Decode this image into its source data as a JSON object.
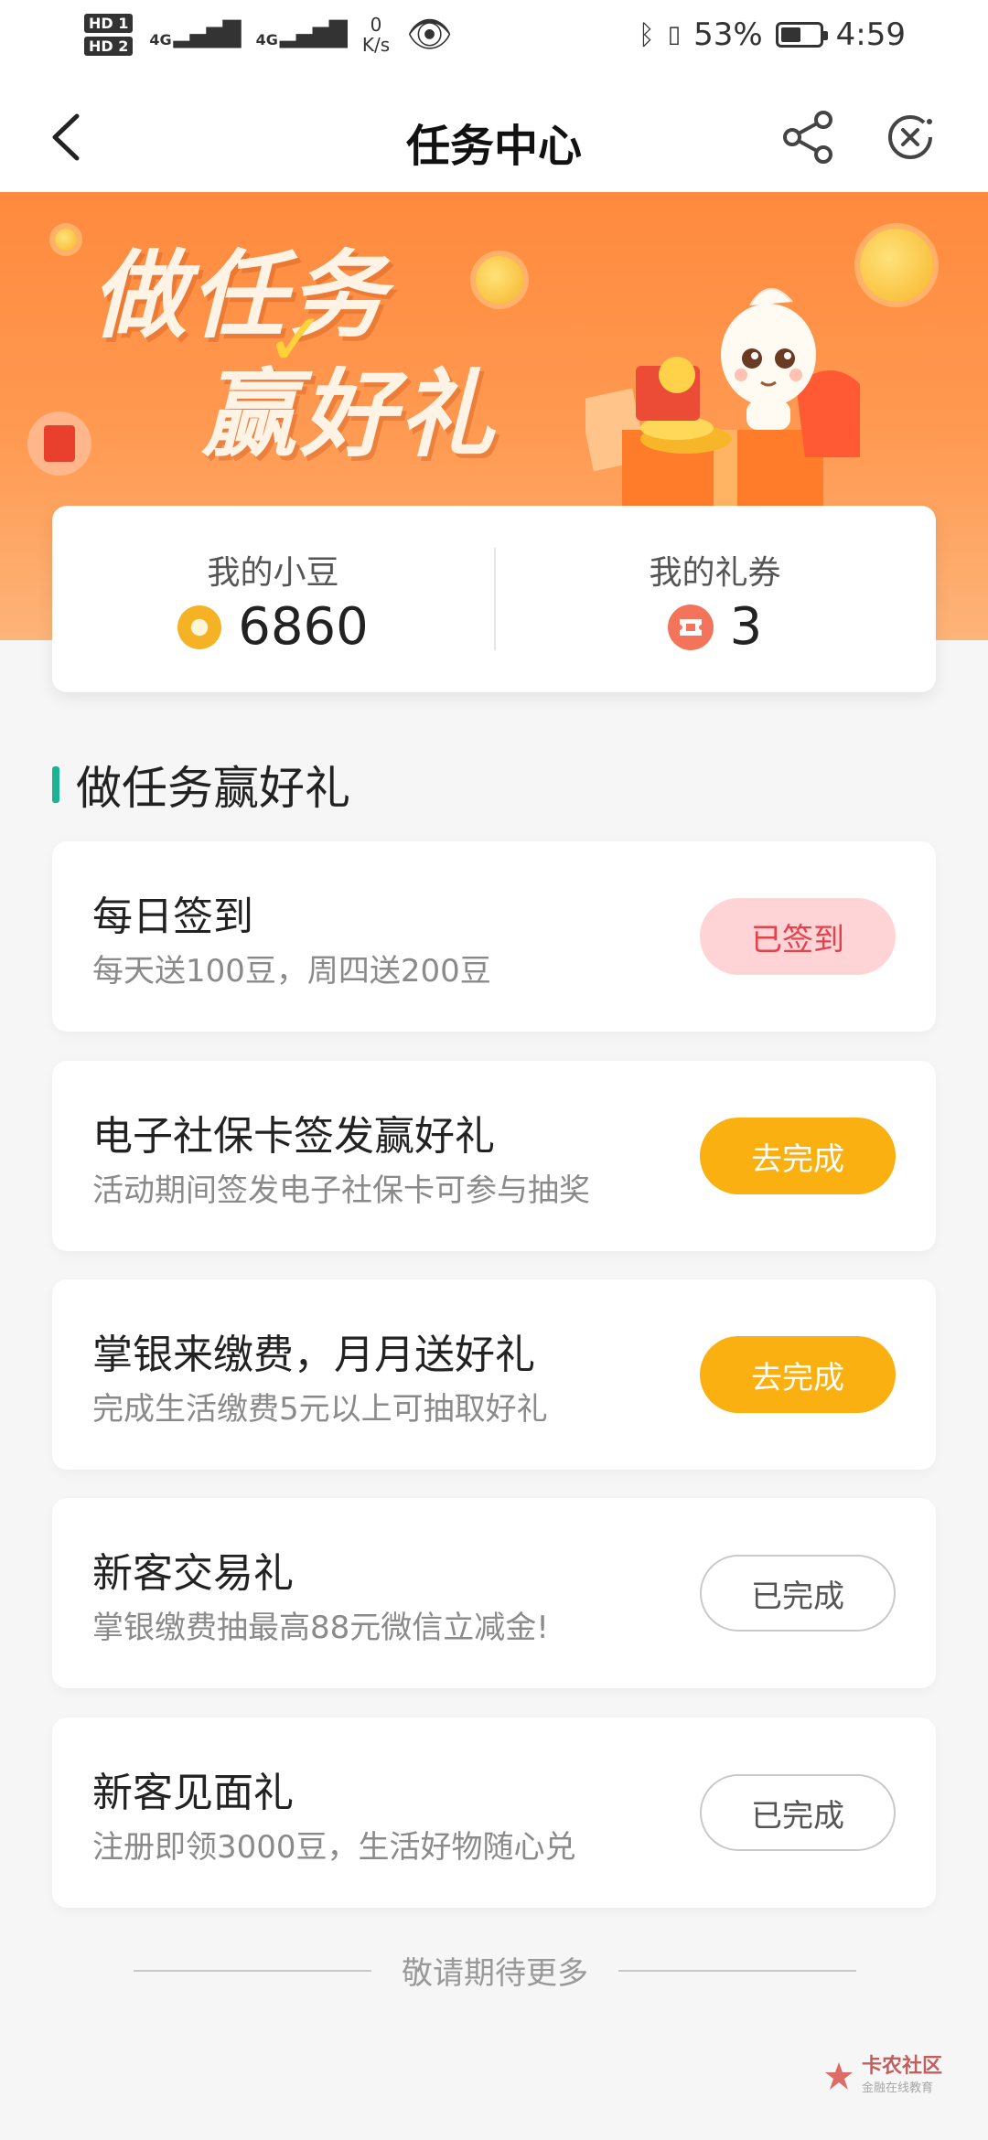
{
  "status_bar": {
    "hd1": "HD 1",
    "hd2": "HD 2",
    "sig1": "4G",
    "sig2": "4G",
    "net_speed": "0",
    "net_unit": "K/s",
    "battery_percent": "53%",
    "battery_level": 0.53,
    "time": "4:59"
  },
  "nav": {
    "title": "任务中心"
  },
  "banner": {
    "line1": "做任务",
    "line2": "赢好礼"
  },
  "balance": {
    "beans_label": "我的小豆",
    "beans_value": "6860",
    "coupons_label": "我的礼券",
    "coupons_value": "3"
  },
  "section": {
    "title": "做任务赢好礼"
  },
  "tasks": [
    {
      "title": "每日签到",
      "desc": "每天送100豆，周四送200豆",
      "button": "已签到",
      "state": "signed"
    },
    {
      "title": "电子社保卡签发赢好礼",
      "desc": "活动期间签发电子社保卡可参与抽奖",
      "button": "去完成",
      "state": "go"
    },
    {
      "title": "掌银来缴费，月月送好礼",
      "desc": "完成生活缴费5元以上可抽取好礼",
      "button": "去完成",
      "state": "go"
    },
    {
      "title": "新客交易礼",
      "desc": "掌银缴费抽最高88元微信立减金!",
      "button": "已完成",
      "state": "done"
    },
    {
      "title": "新客见面礼",
      "desc": "注册即领3000豆，生活好物随心兑",
      "button": "已完成",
      "state": "done"
    }
  ],
  "footer": {
    "text": "敬请期待更多"
  },
  "watermark": {
    "name": "卡农社区",
    "sub": "金融在线教育"
  },
  "colors": {
    "accent_green": "#1ab394",
    "btn_orange": "#fbb011",
    "btn_signed_bg": "#ffd4d6",
    "btn_signed_text": "#e8404a",
    "banner_orange": "#ff8a3d"
  }
}
